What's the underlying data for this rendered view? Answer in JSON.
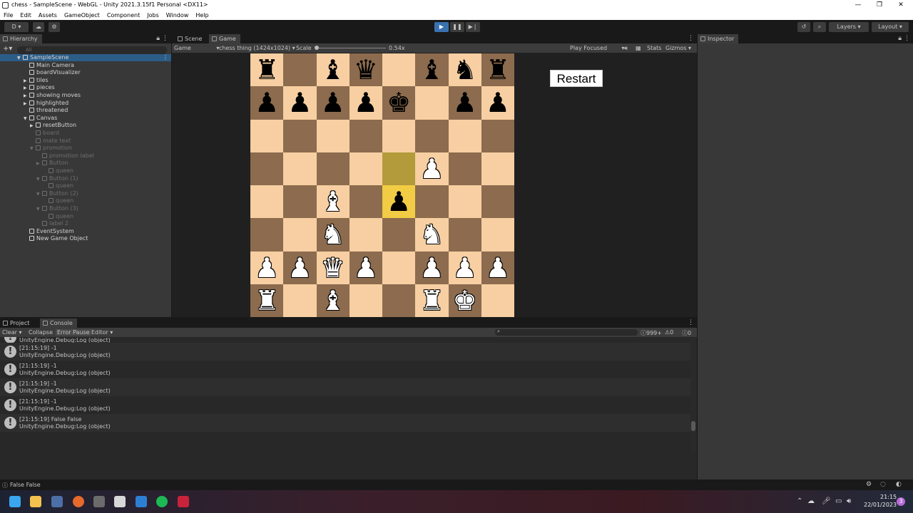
{
  "window": {
    "title": "chess - SampleScene - WebGL - Unity 2021.3.15f1 Personal <DX11>",
    "controls": [
      "—",
      "❐",
      "✕"
    ]
  },
  "menu": [
    "File",
    "Edit",
    "Assets",
    "GameObject",
    "Component",
    "Jobs",
    "Window",
    "Help"
  ],
  "toolbar": {
    "account": "D ▾",
    "layers": "Layers",
    "layout": "Layout"
  },
  "hierarchy": {
    "tab": "Hierarchy",
    "search_placeholder": "All",
    "items": [
      {
        "label": "SampleScene",
        "depth": 0,
        "dim": false,
        "selected": true
      },
      {
        "label": "Main Camera",
        "depth": 1,
        "dim": false
      },
      {
        "label": "boardVisualizer",
        "depth": 1,
        "dim": false
      },
      {
        "label": "tiles",
        "depth": 1,
        "dim": false
      },
      {
        "label": "pieces",
        "depth": 1,
        "dim": false
      },
      {
        "label": "showing moves",
        "depth": 1,
        "dim": false
      },
      {
        "label": "highlighted",
        "depth": 1,
        "dim": false
      },
      {
        "label": "threatened",
        "depth": 1,
        "dim": false
      },
      {
        "label": "Canvas",
        "depth": 1,
        "dim": false
      },
      {
        "label": "resetButton",
        "depth": 2,
        "dim": false
      },
      {
        "label": "board",
        "depth": 2,
        "dim": true
      },
      {
        "label": "mate text",
        "depth": 2,
        "dim": true
      },
      {
        "label": "promotion",
        "depth": 2,
        "dim": true
      },
      {
        "label": "promotion label",
        "depth": 3,
        "dim": true
      },
      {
        "label": "Button",
        "depth": 3,
        "dim": true
      },
      {
        "label": "queen",
        "depth": 4,
        "dim": true
      },
      {
        "label": "Button (1)",
        "depth": 3,
        "dim": true
      },
      {
        "label": "queen",
        "depth": 4,
        "dim": true
      },
      {
        "label": "Button (2)",
        "depth": 3,
        "dim": true
      },
      {
        "label": "queen",
        "depth": 4,
        "dim": true
      },
      {
        "label": "Button (3)",
        "depth": 3,
        "dim": true
      },
      {
        "label": "queen",
        "depth": 4,
        "dim": true
      },
      {
        "label": "label 2",
        "depth": 3,
        "dim": true
      },
      {
        "label": "EventSystem",
        "depth": 1,
        "dim": false
      },
      {
        "label": "New Game Object",
        "depth": 1,
        "dim": false
      }
    ]
  },
  "game": {
    "tabs": [
      "Scene",
      "Game"
    ],
    "display": "Game",
    "resolution": "chess thing (1424x1024)",
    "scale_label": "Scale",
    "scale_value": "0.54x",
    "play_mode": "Play Focused",
    "stats": "Stats",
    "gizmos": "Gizmos",
    "restart_label": "Restart",
    "board": [
      [
        "r",
        "",
        "b",
        "q",
        "",
        "b",
        "n",
        "r"
      ],
      [
        "p",
        "p",
        "p",
        "p",
        "k",
        "",
        "p",
        "p"
      ],
      [
        "",
        "",
        "",
        "",
        "",
        "",
        "",
        ""
      ],
      [
        "",
        "",
        "",
        "",
        "",
        "P",
        "",
        ""
      ],
      [
        "",
        "",
        "B",
        "",
        "p",
        "",
        "",
        ""
      ],
      [
        "",
        "",
        "N",
        "",
        "",
        "N",
        "",
        ""
      ],
      [
        "P",
        "P",
        "Q",
        "P",
        "",
        "P",
        "P",
        "P"
      ],
      [
        "R",
        "",
        "B",
        "",
        "",
        "R",
        "K",
        ""
      ]
    ],
    "highlight_from": "e5",
    "highlight_to": "e4"
  },
  "inspector": {
    "tab": "Inspector"
  },
  "console": {
    "tabs": [
      "Project",
      "Console"
    ],
    "clear": "Clear",
    "collapse": "Collapse",
    "error_pause": "Error Pause",
    "editor": "Editor",
    "count_log": "999+",
    "count_warn": "0",
    "count_err": "0",
    "rows": [
      {
        "line1": "",
        "line2": "UnityEngine.Debug:Log (object)"
      },
      {
        "line1": "[21:15:19] -1",
        "line2": "UnityEngine.Debug:Log (object)"
      },
      {
        "line1": "[21:15:19] -1",
        "line2": "UnityEngine.Debug:Log (object)"
      },
      {
        "line1": "[21:15:19] -1",
        "line2": "UnityEngine.Debug:Log (object)"
      },
      {
        "line1": "[21:15:19] -1",
        "line2": "UnityEngine.Debug:Log (object)"
      },
      {
        "line1": "[21:15:19] False False",
        "line2": "UnityEngine.Debug:Log (object)"
      }
    ]
  },
  "status": {
    "text": "False False"
  },
  "taskbar": {
    "time": "21:15",
    "date": "22/01/2023",
    "notifications": "3"
  }
}
